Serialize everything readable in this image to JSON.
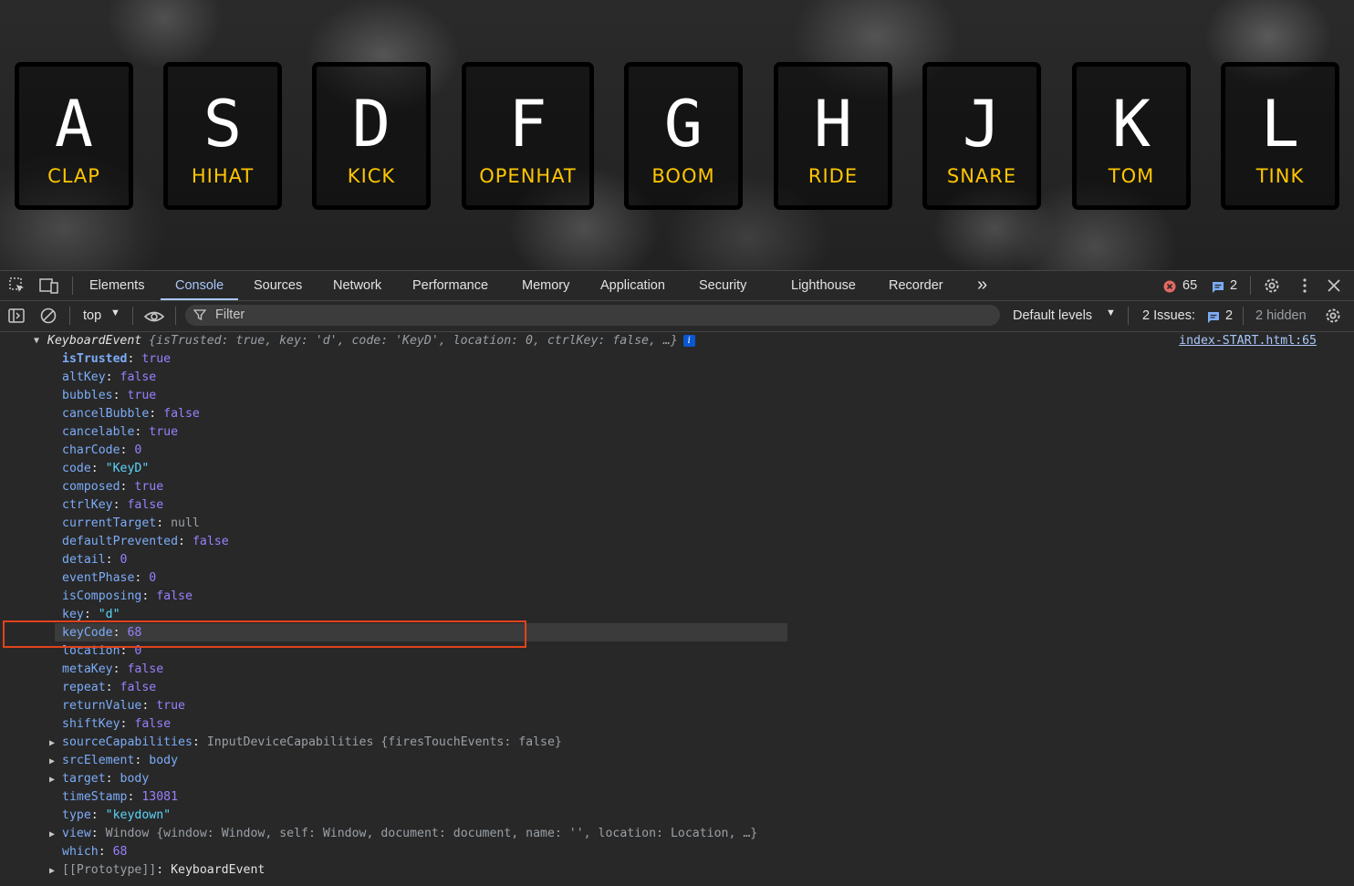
{
  "drum_keys": [
    {
      "letter": "A",
      "sound": "CLAP"
    },
    {
      "letter": "S",
      "sound": "HIHAT"
    },
    {
      "letter": "D",
      "sound": "KICK"
    },
    {
      "letter": "F",
      "sound": "OPENHAT"
    },
    {
      "letter": "G",
      "sound": "BOOM"
    },
    {
      "letter": "H",
      "sound": "RIDE"
    },
    {
      "letter": "J",
      "sound": "SNARE"
    },
    {
      "letter": "K",
      "sound": "TOM"
    },
    {
      "letter": "L",
      "sound": "TINK"
    }
  ],
  "devtools": {
    "tabs": [
      "Elements",
      "Console",
      "Sources",
      "Network",
      "Performance",
      "Memory",
      "Application",
      "Security",
      "Lighthouse",
      "Recorder"
    ],
    "active_tab": "Console",
    "more_tabs": "»",
    "error_count": "65",
    "message_count": "2"
  },
  "toolbar": {
    "context": "top",
    "filter_placeholder": "Filter",
    "levels": "Default levels",
    "issues_label": "2 Issues:",
    "issues_count": "2",
    "hidden": "2 hidden"
  },
  "console": {
    "header_prefix": "KeyboardEvent",
    "header_preview": "{isTrusted: true, key: 'd', code: 'KeyD', location: 0, ctrlKey: false, …}",
    "source_link": "index-START.html:65",
    "props": [
      {
        "key": "isTrusted",
        "value": "true"
      },
      {
        "key": "altKey",
        "value": "false"
      },
      {
        "key": "bubbles",
        "value": "true"
      },
      {
        "key": "cancelBubble",
        "value": "false"
      },
      {
        "key": "cancelable",
        "value": "true"
      },
      {
        "key": "charCode",
        "value": "0"
      },
      {
        "key": "code",
        "value": "\"KeyD\""
      },
      {
        "key": "composed",
        "value": "true"
      },
      {
        "key": "ctrlKey",
        "value": "false"
      },
      {
        "key": "currentTarget",
        "value": "null"
      },
      {
        "key": "defaultPrevented",
        "value": "false"
      },
      {
        "key": "detail",
        "value": "0"
      },
      {
        "key": "eventPhase",
        "value": "0"
      },
      {
        "key": "isComposing",
        "value": "false"
      },
      {
        "key": "key",
        "value": "\"d\""
      },
      {
        "key": "keyCode",
        "value": "68"
      },
      {
        "key": "location",
        "value": "0"
      },
      {
        "key": "metaKey",
        "value": "false"
      },
      {
        "key": "repeat",
        "value": "false"
      },
      {
        "key": "returnValue",
        "value": "true"
      },
      {
        "key": "shiftKey",
        "value": "false"
      },
      {
        "key": "sourceCapabilities",
        "value": "InputDeviceCapabilities {firesTouchEvents: false}"
      },
      {
        "key": "srcElement",
        "value": "body"
      },
      {
        "key": "target",
        "value": "body"
      },
      {
        "key": "timeStamp",
        "value": "13081"
      },
      {
        "key": "type",
        "value": "\"keydown\""
      },
      {
        "key": "view",
        "value": "Window {window: Window, self: Window, document: document, name: '', location: Location, …}"
      },
      {
        "key": "which",
        "value": "68"
      },
      {
        "key": "[[Prototype]]",
        "value": "KeyboardEvent"
      }
    ]
  }
}
